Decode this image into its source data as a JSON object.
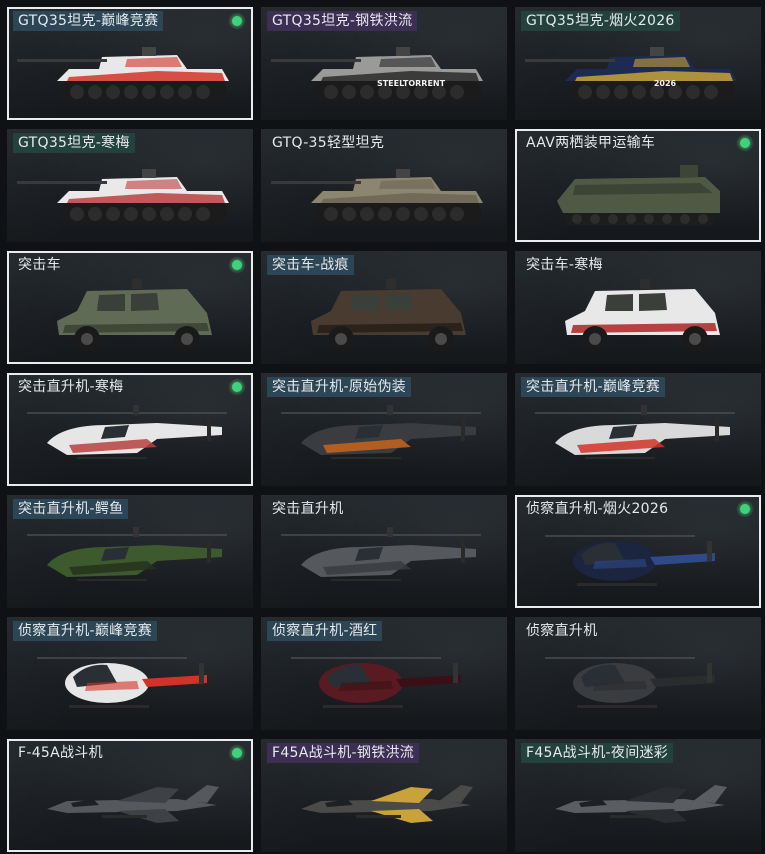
{
  "vehicles": [
    {
      "name": "GTQ35坦克-巅峰竞赛",
      "tag": "blue",
      "selected": true,
      "owned": true,
      "kind": "tank",
      "body": "#e8e8e8",
      "accent": "#d33227",
      "decal": ""
    },
    {
      "name": "GTQ35坦克-钢铁洪流",
      "tag": "purple",
      "selected": false,
      "owned": false,
      "kind": "tank",
      "body": "#9a9a98",
      "accent": "#2a2a2a",
      "decal": "STEELTORRENT"
    },
    {
      "name": "GTQ35坦克-烟火2026",
      "tag": "teal",
      "selected": false,
      "owned": false,
      "kind": "tank",
      "body": "#1d2a52",
      "accent": "#c9a23a",
      "decal": "2026"
    },
    {
      "name": "GTQ35坦克-寒梅",
      "tag": "teal",
      "selected": false,
      "owned": false,
      "kind": "tank",
      "body": "#e9e9e9",
      "accent": "#b84040",
      "decal": ""
    },
    {
      "name": "GTQ-35轻型坦克",
      "tag": "none",
      "selected": false,
      "owned": false,
      "kind": "tank",
      "body": "#8c8670",
      "accent": "#6b6654",
      "decal": ""
    },
    {
      "name": "AAV两栖装甲运输车",
      "tag": "none",
      "selected": true,
      "owned": true,
      "kind": "aav",
      "body": "#4f5a45",
      "accent": "#3c4436",
      "decal": ""
    },
    {
      "name": "突击车",
      "tag": "none",
      "selected": true,
      "owned": true,
      "kind": "car",
      "body": "#5f6b55",
      "accent": "#3f4738",
      "decal": ""
    },
    {
      "name": "突击车-战痕",
      "tag": "blue",
      "selected": false,
      "owned": false,
      "kind": "car",
      "body": "#4a3b30",
      "accent": "#2b221c",
      "decal": ""
    },
    {
      "name": "突击车-寒梅",
      "tag": "none",
      "selected": false,
      "owned": false,
      "kind": "car",
      "body": "#e8e8e8",
      "accent": "#b84040",
      "decal": ""
    },
    {
      "name": "突击直升机-寒梅",
      "tag": "none",
      "selected": true,
      "owned": true,
      "kind": "attack_heli",
      "body": "#e6e6e6",
      "accent": "#b84040",
      "decal": ""
    },
    {
      "name": "突击直升机-原始伪装",
      "tag": "blue",
      "selected": false,
      "owned": false,
      "kind": "attack_heli",
      "body": "#3a3c3f",
      "accent": "#c8641e",
      "decal": ""
    },
    {
      "name": "突击直升机-巅峰竞赛",
      "tag": "blue",
      "selected": false,
      "owned": false,
      "kind": "attack_heli",
      "body": "#d9d9d9",
      "accent": "#d33227",
      "decal": ""
    },
    {
      "name": "突击直升机-鳄鱼",
      "tag": "blue",
      "selected": false,
      "owned": false,
      "kind": "attack_heli",
      "body": "#3d5a2e",
      "accent": "#23321c",
      "decal": ""
    },
    {
      "name": "突击直升机",
      "tag": "none",
      "selected": false,
      "owned": false,
      "kind": "attack_heli",
      "body": "#55585c",
      "accent": "#3a3c3f",
      "decal": ""
    },
    {
      "name": "侦察直升机-烟火2026",
      "tag": "none",
      "selected": true,
      "owned": true,
      "kind": "scout_heli",
      "body": "#1b2540",
      "accent": "#2f4a8a",
      "decal": ""
    },
    {
      "name": "侦察直升机-巅峰竞赛",
      "tag": "blue",
      "selected": false,
      "owned": false,
      "kind": "scout_heli",
      "body": "#e6e6e6",
      "accent": "#d33227",
      "decal": ""
    },
    {
      "name": "侦察直升机-酒红",
      "tag": "blue",
      "selected": false,
      "owned": false,
      "kind": "scout_heli",
      "body": "#5a1a22",
      "accent": "#3a1016",
      "decal": ""
    },
    {
      "name": "侦察直升机",
      "tag": "none",
      "selected": false,
      "owned": false,
      "kind": "scout_heli",
      "body": "#3a3c3f",
      "accent": "#2a2c2e",
      "decal": ""
    },
    {
      "name": "F-45A战斗机",
      "tag": "none",
      "selected": true,
      "owned": true,
      "kind": "jet",
      "body": "#55585c",
      "accent": "#3f4245",
      "decal": ""
    },
    {
      "name": "F45A战斗机-钢铁洪流",
      "tag": "purple",
      "selected": false,
      "owned": false,
      "kind": "jet",
      "body": "#4a4a48",
      "accent": "#c9a23a",
      "decal": ""
    },
    {
      "name": "F45A战斗机-夜间迷彩",
      "tag": "teal",
      "selected": false,
      "owned": false,
      "kind": "jet",
      "body": "#5a5d62",
      "accent": "#2b2d30",
      "decal": ""
    }
  ]
}
